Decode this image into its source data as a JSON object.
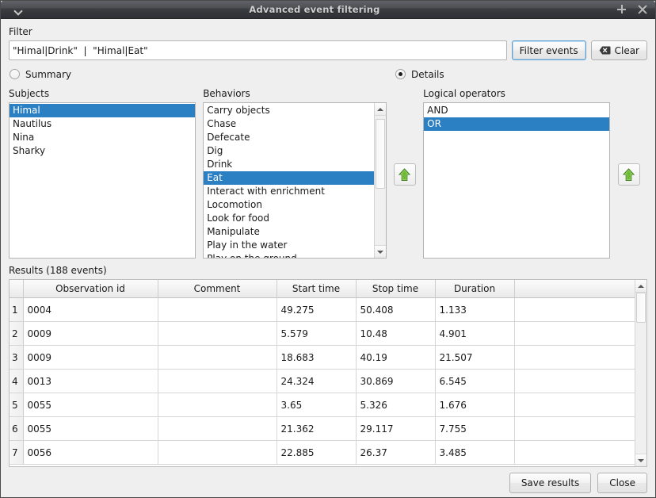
{
  "window": {
    "title": "Advanced event filtering",
    "menu_icon": "chevron-down-icon",
    "maximize_icon": "maximize-icon",
    "close_icon": "close-icon"
  },
  "filter": {
    "label": "Filter",
    "value": "\"Himal|Drink\"  |  \"Himal|Eat\"",
    "placeholder": "",
    "filter_button": "Filter events",
    "clear_button": "Clear",
    "clear_icon": "backspace-icon"
  },
  "mode": {
    "summary_label": "Summary",
    "details_label": "Details",
    "selected": "Details"
  },
  "subjects": {
    "label": "Subjects",
    "items": [
      {
        "label": "Himal",
        "selected": true
      },
      {
        "label": "Nautilus",
        "selected": false
      },
      {
        "label": "Nina",
        "selected": false
      },
      {
        "label": "Sharky",
        "selected": false
      }
    ]
  },
  "behaviors": {
    "label": "Behaviors",
    "items": [
      {
        "label": "Carry objects",
        "selected": false
      },
      {
        "label": "Chase",
        "selected": false
      },
      {
        "label": "Defecate",
        "selected": false
      },
      {
        "label": "Dig",
        "selected": false
      },
      {
        "label": "Drink",
        "selected": false
      },
      {
        "label": "Eat",
        "selected": true
      },
      {
        "label": "Interact with enrichment",
        "selected": false
      },
      {
        "label": "Locomotion",
        "selected": false
      },
      {
        "label": "Look for food",
        "selected": false
      },
      {
        "label": "Manipulate",
        "selected": false
      },
      {
        "label": "Play in the water",
        "selected": false
      },
      {
        "label": "Play on the ground",
        "selected": false
      }
    ]
  },
  "logical_operators": {
    "label": "Logical operators",
    "items": [
      {
        "label": "AND",
        "selected": false
      },
      {
        "label": "OR",
        "selected": true
      }
    ]
  },
  "add_buttons": {
    "behaviors_add_icon": "green-up-arrow-icon",
    "operators_add_icon": "green-up-arrow-icon"
  },
  "results": {
    "label": "Results (188 events)",
    "columns": [
      "Observation id",
      "Comment",
      "Start time",
      "Stop time",
      "Duration"
    ],
    "rows": [
      {
        "n": "1",
        "observation_id": "0004",
        "comment": "",
        "start": "49.275",
        "stop": "50.408",
        "duration": "1.133"
      },
      {
        "n": "2",
        "observation_id": "0009",
        "comment": "",
        "start": "5.579",
        "stop": "10.48",
        "duration": "4.901"
      },
      {
        "n": "3",
        "observation_id": "0009",
        "comment": "",
        "start": "18.683",
        "stop": "40.19",
        "duration": "21.507"
      },
      {
        "n": "4",
        "observation_id": "0013",
        "comment": "",
        "start": "24.324",
        "stop": "30.869",
        "duration": "6.545"
      },
      {
        "n": "5",
        "observation_id": "0055",
        "comment": "",
        "start": "3.65",
        "stop": "5.326",
        "duration": "1.676"
      },
      {
        "n": "6",
        "observation_id": "0055",
        "comment": "",
        "start": "21.362",
        "stop": "29.117",
        "duration": "7.755"
      },
      {
        "n": "7",
        "observation_id": "0056",
        "comment": "",
        "start": "22.885",
        "stop": "26.37",
        "duration": "3.485"
      }
    ]
  },
  "footer": {
    "save_label": "Save results",
    "close_label": "Close"
  },
  "colors": {
    "selection": "#2b7fc3",
    "accent_focus": "#5a9fd4",
    "window_bg": "#efefef",
    "arrow_green": "#5aab2b"
  }
}
